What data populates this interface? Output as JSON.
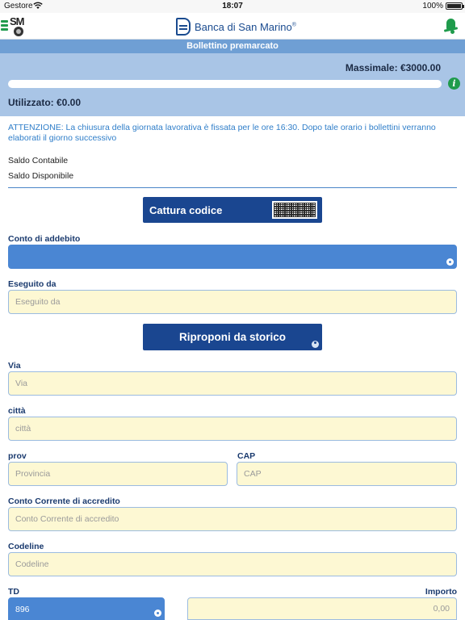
{
  "status_bar": {
    "carrier": "Gestore",
    "time": "18:07",
    "battery": "100%"
  },
  "header": {
    "brand": "Banca di San Marino",
    "brand_suffix": "®",
    "logo_text": "SM"
  },
  "section": {
    "title": "Bollettino premarcato"
  },
  "limits": {
    "max_label": "Massimale: €3000.00",
    "used_label": "Utilizzato: €0.00",
    "used_fraction": 0.0
  },
  "notice": "ATTENZIONE: La chiusura della giornata lavorativa è fissata per le ore 16:30. Dopo tale orario i bollettini verranno elaborati il giorno successivo",
  "saldo": {
    "contabile": "Saldo Contabile",
    "disponibile": "Saldo Disponibile"
  },
  "buttons": {
    "capture": "Cattura codice",
    "history": "Riproponi da storico"
  },
  "form": {
    "conto_addebito": {
      "label": "Conto di addebito",
      "value": ""
    },
    "eseguito_da": {
      "label": "Eseguito da",
      "placeholder": "Eseguito da"
    },
    "via": {
      "label": "Via",
      "placeholder": "Via"
    },
    "citta": {
      "label": "città",
      "placeholder": "città"
    },
    "prov": {
      "label": "prov",
      "placeholder": "Provincia"
    },
    "cap": {
      "label": "CAP",
      "placeholder": "CAP"
    },
    "conto_accredito": {
      "label": "Conto Corrente di accredito",
      "placeholder": "Conto Corrente di accredito"
    },
    "codeline": {
      "label": "Codeline",
      "placeholder": "Codeline"
    },
    "td": {
      "label": "TD",
      "value": "896"
    },
    "importo": {
      "label": "Importo",
      "placeholder": "0,00"
    }
  },
  "colors": {
    "accent": "#1f9b4c",
    "primary": "#1a4690",
    "header": "#6f9fd4",
    "panel": "#a9c5e6",
    "field_bg": "#fdf8d3",
    "notice": "#2f7ec9"
  }
}
